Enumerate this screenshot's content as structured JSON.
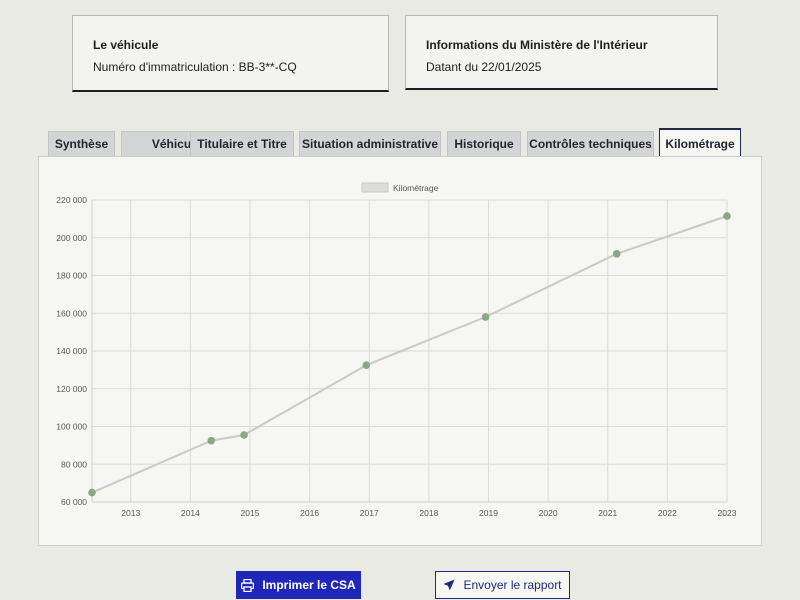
{
  "vehicle_card": {
    "title": "Le véhicule",
    "registration": "Numéro d'immatriculation : BB-3**-CQ"
  },
  "ministry_card": {
    "title": "Informations du Ministère de l'Intérieur",
    "date": "Datant du 22/01/2025"
  },
  "tabs": [
    {
      "label": "Synthèse",
      "active": false
    },
    {
      "label": "Véhicule",
      "active": false
    },
    {
      "label": "Titulaire et Titre",
      "active": false
    },
    {
      "label": "Situation administrative",
      "active": false
    },
    {
      "label": "Historique",
      "active": false
    },
    {
      "label": "Contrôles techniques",
      "active": false
    },
    {
      "label": "Kilométrage",
      "active": true
    }
  ],
  "chart_data": {
    "type": "line",
    "legend": [
      "Kilométrage"
    ],
    "legend_position": "top-center",
    "grid": true,
    "x_ticks": [
      "2013",
      "2014",
      "2015",
      "2016",
      "2017",
      "2018",
      "2019",
      "2020",
      "2021",
      "2022",
      "2023"
    ],
    "y_ticks": [
      "60 000",
      "80 000",
      "100 000",
      "120 000",
      "140 000",
      "160 000",
      "180 000",
      "200 000",
      "220 000"
    ],
    "ylim": [
      60000,
      220000
    ],
    "xlim": [
      2012.35,
      2023.0
    ],
    "series": [
      {
        "name": "Kilométrage",
        "color": "#c8cac6",
        "point_color": "#86a882",
        "points": [
          {
            "x": 2012.35,
            "y": 65000
          },
          {
            "x": 2014.35,
            "y": 92500
          },
          {
            "x": 2014.9,
            "y": 95500
          },
          {
            "x": 2016.95,
            "y": 132500
          },
          {
            "x": 2018.95,
            "y": 158000
          },
          {
            "x": 2021.15,
            "y": 191500
          },
          {
            "x": 2023.0,
            "y": 211500
          }
        ]
      }
    ]
  },
  "actions": {
    "print_label": "Imprimer le CSA",
    "send_label": "Envoyer le rapport"
  },
  "icons": {
    "print": "printer-icon",
    "send": "send-arrow-icon"
  }
}
